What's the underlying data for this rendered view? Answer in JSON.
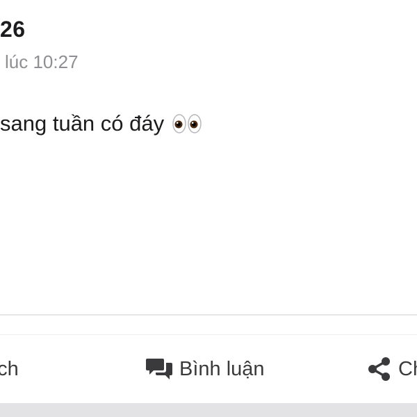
{
  "post": {
    "author": "26",
    "time": "lúc 10:27",
    "text": "sang tuần có đáy",
    "emoji": "eyes-emoji"
  },
  "actions": {
    "like_label": "hích",
    "comment_label": "Bình luận",
    "share_label": "Ch"
  },
  "icons": {
    "comment": "comment-bubbles-icon",
    "share": "share-icon"
  },
  "colors": {
    "text": "#1c1c1e",
    "secondary_text": "#8e8e93",
    "action_text": "#3a3a3c",
    "icon": "#3a3a3c",
    "divider": "#e6e6e8",
    "bottom_bar": "#e3e3e5"
  }
}
